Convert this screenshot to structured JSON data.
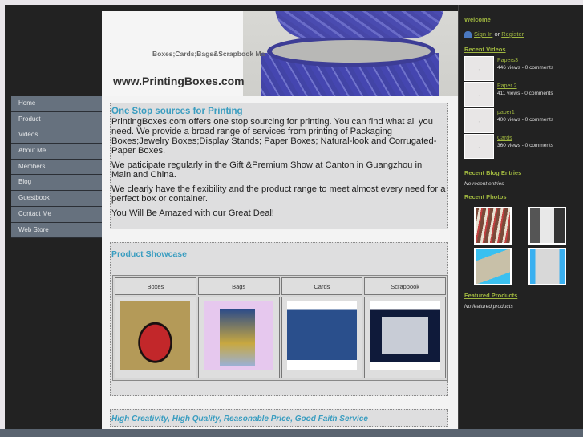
{
  "header": {
    "tagline": "Boxes;Cards;Bags&Scrapbook Ma",
    "site_title": "www.PrintingBoxes.com"
  },
  "nav": [
    "Home",
    "Product",
    "Videos",
    "About Me",
    "Members",
    "Blog",
    "Guestbook",
    "Contact Me",
    "Web Store"
  ],
  "intro": {
    "title": "One Stop sources for Printing",
    "paragraphs": [
      "PrintingBoxes.com offers one stop sourcing for printing. You can find what all you need. We provide a broad range of services from printing of Packaging Boxes;Jewelry Boxes;Display Stands; Paper Boxes; Natural-look and Corrugated-Paper Boxes.",
      "We paticipate regularly in the Gift &Premium Show at Canton in Guangzhou in  Mainland China.",
      "We clearly have the flexibility and the product range to meet almost every need for a perfect box or container.",
      "You Will Be Amazed with our Great Deal!"
    ]
  },
  "showcase": {
    "title": "Product Showcase",
    "columns": [
      "Boxes",
      "Bags",
      "Cards",
      "Scrapbook"
    ]
  },
  "slogan": "High Creativity, High Quality, Reasonable Price, Good Faith Service",
  "sidebar": {
    "welcome": "Welcome",
    "sign_in": "Sign In",
    "or": "or",
    "register": "Register",
    "recent_videos": "Recent Videos",
    "videos": [
      {
        "title": "Papers3",
        "meta": "446 views - 0 comments"
      },
      {
        "title": "Paper 2",
        "meta": "411 views - 0 comments"
      },
      {
        "title": "paper1",
        "meta": "400 views - 0 comments"
      },
      {
        "title": "Cards",
        "meta": "360 views - 0 comments"
      }
    ],
    "recent_blog": "Recent Blog Entries",
    "no_blog": "No recent entries",
    "recent_photos": "Recent Photos",
    "featured": "Featured Products",
    "no_featured": "No featured products"
  }
}
